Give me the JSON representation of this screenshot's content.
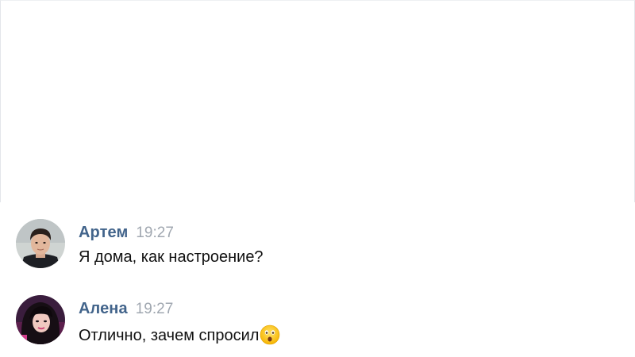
{
  "messages": [
    {
      "author": "Артем",
      "time": "19:27",
      "text": "Я дома, как настроение?",
      "avatar": "avatar-male-photo"
    },
    {
      "author": "Алена",
      "time": "19:27",
      "text": "Отлично, зачем спросил",
      "avatar": "avatar-female-photo",
      "emoji": "astonished-face-emoji"
    }
  ],
  "colors": {
    "author_name": "#42648b",
    "timestamp": "#a0a7b0",
    "message_text": "#111111",
    "background": "#ffffff"
  }
}
